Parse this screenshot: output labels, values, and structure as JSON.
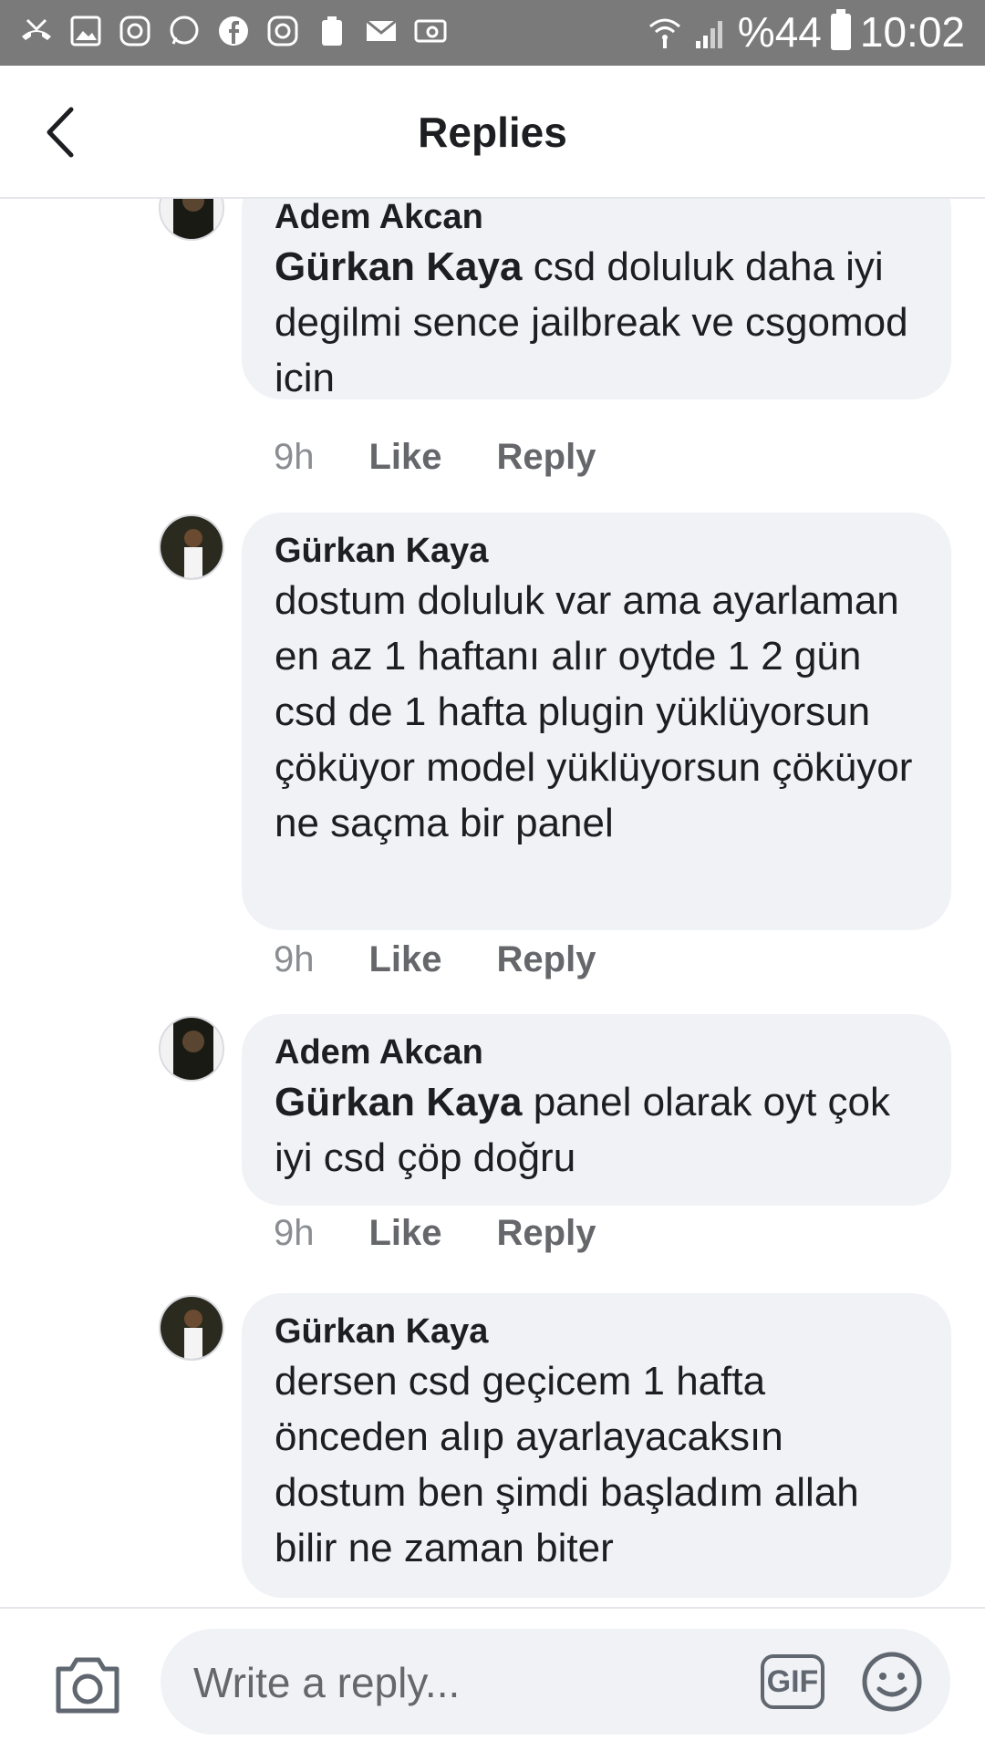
{
  "status_bar": {
    "battery": "%44",
    "time": "10:02"
  },
  "header": {
    "title": "Replies"
  },
  "comments": [
    {
      "author": "Adem Akcan",
      "mention": "Gürkan Kaya",
      "text": " csd doluluk daha iyi degilmi sence jailbreak ve csgomod icin",
      "time": "9h",
      "like": "Like",
      "reply": "Reply"
    },
    {
      "author": "Gürkan Kaya",
      "mention": "",
      "text": "dostum doluluk var ama ayarlaman en az 1 haftanı alır oytde 1 2 gün csd de 1 hafta plugin yüklüyorsun çöküyor model yüklüyorsun çöküyor ne saçma bir panel",
      "time": "9h",
      "like": "Like",
      "reply": "Reply"
    },
    {
      "author": "Adem Akcan",
      "mention": "Gürkan Kaya",
      "text": " panel olarak oyt çok iyi csd çöp doğru",
      "time": "9h",
      "like": "Like",
      "reply": "Reply"
    },
    {
      "author": "Gürkan Kaya",
      "mention": "",
      "text": "dersen csd geçicem 1 hafta önceden alıp ayarlayacaksın dostum ben şimdi başladım allah bilir ne zaman biter",
      "time": "",
      "like": "",
      "reply": ""
    }
  ],
  "composer": {
    "placeholder": "Write a reply...",
    "gif_label": "GIF"
  }
}
